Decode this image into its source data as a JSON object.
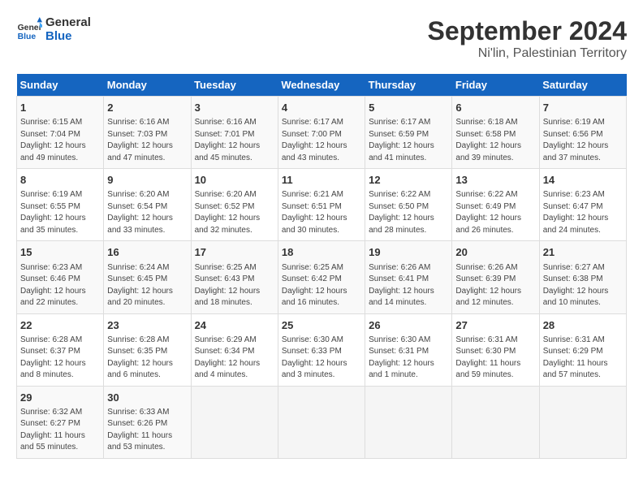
{
  "header": {
    "logo_line1": "General",
    "logo_line2": "Blue",
    "main_title": "September 2024",
    "subtitle": "Ni'lin, Palestinian Territory"
  },
  "days_of_week": [
    "Sunday",
    "Monday",
    "Tuesday",
    "Wednesday",
    "Thursday",
    "Friday",
    "Saturday"
  ],
  "weeks": [
    [
      {
        "day": "1",
        "sunrise": "6:15 AM",
        "sunset": "7:04 PM",
        "daylight": "12 hours and 49 minutes."
      },
      {
        "day": "2",
        "sunrise": "6:16 AM",
        "sunset": "7:03 PM",
        "daylight": "12 hours and 47 minutes."
      },
      {
        "day": "3",
        "sunrise": "6:16 AM",
        "sunset": "7:01 PM",
        "daylight": "12 hours and 45 minutes."
      },
      {
        "day": "4",
        "sunrise": "6:17 AM",
        "sunset": "7:00 PM",
        "daylight": "12 hours and 43 minutes."
      },
      {
        "day": "5",
        "sunrise": "6:17 AM",
        "sunset": "6:59 PM",
        "daylight": "12 hours and 41 minutes."
      },
      {
        "day": "6",
        "sunrise": "6:18 AM",
        "sunset": "6:58 PM",
        "daylight": "12 hours and 39 minutes."
      },
      {
        "day": "7",
        "sunrise": "6:19 AM",
        "sunset": "6:56 PM",
        "daylight": "12 hours and 37 minutes."
      }
    ],
    [
      {
        "day": "8",
        "sunrise": "6:19 AM",
        "sunset": "6:55 PM",
        "daylight": "12 hours and 35 minutes."
      },
      {
        "day": "9",
        "sunrise": "6:20 AM",
        "sunset": "6:54 PM",
        "daylight": "12 hours and 33 minutes."
      },
      {
        "day": "10",
        "sunrise": "6:20 AM",
        "sunset": "6:52 PM",
        "daylight": "12 hours and 32 minutes."
      },
      {
        "day": "11",
        "sunrise": "6:21 AM",
        "sunset": "6:51 PM",
        "daylight": "12 hours and 30 minutes."
      },
      {
        "day": "12",
        "sunrise": "6:22 AM",
        "sunset": "6:50 PM",
        "daylight": "12 hours and 28 minutes."
      },
      {
        "day": "13",
        "sunrise": "6:22 AM",
        "sunset": "6:49 PM",
        "daylight": "12 hours and 26 minutes."
      },
      {
        "day": "14",
        "sunrise": "6:23 AM",
        "sunset": "6:47 PM",
        "daylight": "12 hours and 24 minutes."
      }
    ],
    [
      {
        "day": "15",
        "sunrise": "6:23 AM",
        "sunset": "6:46 PM",
        "daylight": "12 hours and 22 minutes."
      },
      {
        "day": "16",
        "sunrise": "6:24 AM",
        "sunset": "6:45 PM",
        "daylight": "12 hours and 20 minutes."
      },
      {
        "day": "17",
        "sunrise": "6:25 AM",
        "sunset": "6:43 PM",
        "daylight": "12 hours and 18 minutes."
      },
      {
        "day": "18",
        "sunrise": "6:25 AM",
        "sunset": "6:42 PM",
        "daylight": "12 hours and 16 minutes."
      },
      {
        "day": "19",
        "sunrise": "6:26 AM",
        "sunset": "6:41 PM",
        "daylight": "12 hours and 14 minutes."
      },
      {
        "day": "20",
        "sunrise": "6:26 AM",
        "sunset": "6:39 PM",
        "daylight": "12 hours and 12 minutes."
      },
      {
        "day": "21",
        "sunrise": "6:27 AM",
        "sunset": "6:38 PM",
        "daylight": "12 hours and 10 minutes."
      }
    ],
    [
      {
        "day": "22",
        "sunrise": "6:28 AM",
        "sunset": "6:37 PM",
        "daylight": "12 hours and 8 minutes."
      },
      {
        "day": "23",
        "sunrise": "6:28 AM",
        "sunset": "6:35 PM",
        "daylight": "12 hours and 6 minutes."
      },
      {
        "day": "24",
        "sunrise": "6:29 AM",
        "sunset": "6:34 PM",
        "daylight": "12 hours and 4 minutes."
      },
      {
        "day": "25",
        "sunrise": "6:30 AM",
        "sunset": "6:33 PM",
        "daylight": "12 hours and 3 minutes."
      },
      {
        "day": "26",
        "sunrise": "6:30 AM",
        "sunset": "6:31 PM",
        "daylight": "12 hours and 1 minute."
      },
      {
        "day": "27",
        "sunrise": "6:31 AM",
        "sunset": "6:30 PM",
        "daylight": "11 hours and 59 minutes."
      },
      {
        "day": "28",
        "sunrise": "6:31 AM",
        "sunset": "6:29 PM",
        "daylight": "11 hours and 57 minutes."
      }
    ],
    [
      {
        "day": "29",
        "sunrise": "6:32 AM",
        "sunset": "6:27 PM",
        "daylight": "11 hours and 55 minutes."
      },
      {
        "day": "30",
        "sunrise": "6:33 AM",
        "sunset": "6:26 PM",
        "daylight": "11 hours and 53 minutes."
      },
      null,
      null,
      null,
      null,
      null
    ]
  ],
  "labels": {
    "sunrise_prefix": "Sunrise: ",
    "sunset_prefix": "Sunset: ",
    "daylight_prefix": "Daylight: "
  }
}
